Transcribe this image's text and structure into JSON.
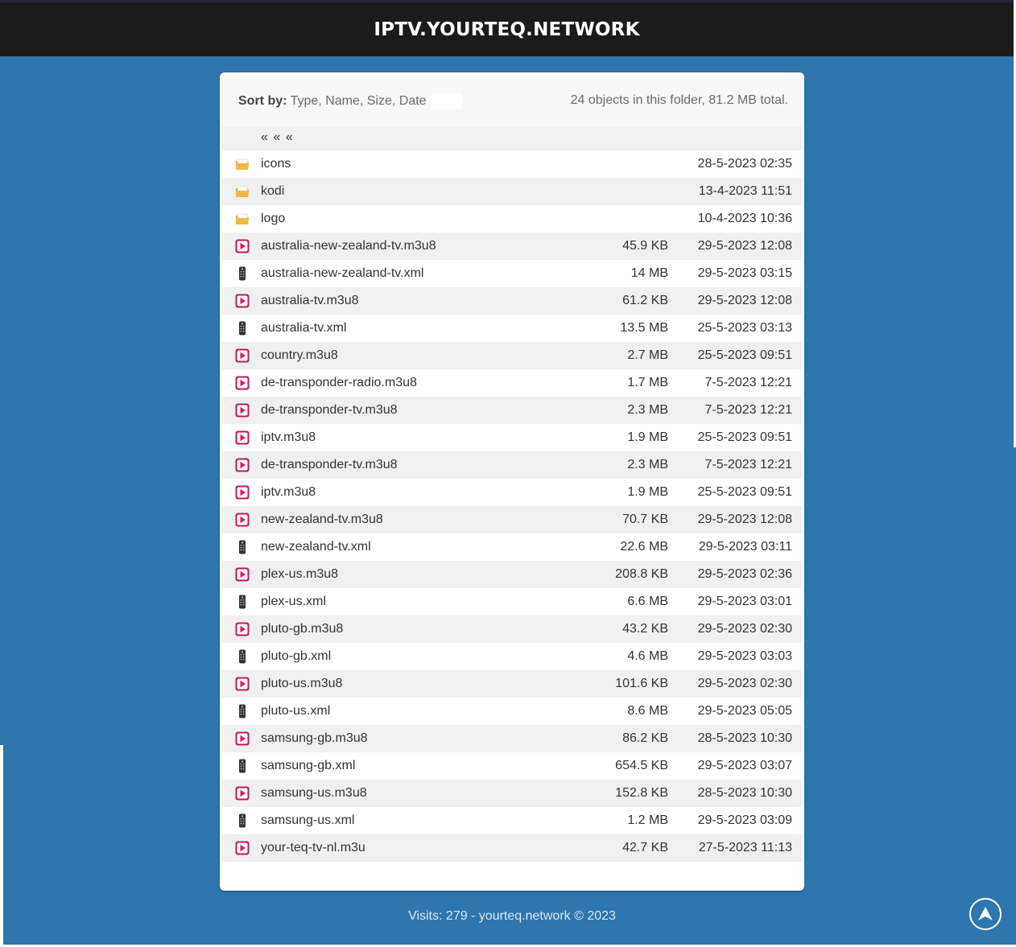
{
  "header": {
    "title": "IPTV.YOURTEQ.NETWORK"
  },
  "sort": {
    "label": "Sort by:",
    "options": "Type, Name, Size, Date"
  },
  "summary": "24 objects in this folder, 81.2 MB total.",
  "parent_link": "« « «",
  "rows": [
    {
      "type": "folder",
      "name": "icons",
      "size": "",
      "date": "28-5-2023 02:35"
    },
    {
      "type": "folder",
      "name": "kodi",
      "size": "",
      "date": "13-4-2023 11:51"
    },
    {
      "type": "folder",
      "name": "logo",
      "size": "",
      "date": "10-4-2023 10:36"
    },
    {
      "type": "playlist",
      "name": "australia-new-zealand-tv.m3u8",
      "size": "45.9 KB",
      "date": "29-5-2023 12:08"
    },
    {
      "type": "xml",
      "name": "australia-new-zealand-tv.xml",
      "size": "14 MB",
      "date": "29-5-2023 03:15"
    },
    {
      "type": "playlist",
      "name": "australia-tv.m3u8",
      "size": "61.2 KB",
      "date": "29-5-2023 12:08"
    },
    {
      "type": "xml",
      "name": "australia-tv.xml",
      "size": "13.5 MB",
      "date": "25-5-2023 03:13"
    },
    {
      "type": "playlist",
      "name": "country.m3u8",
      "size": "2.7 MB",
      "date": "25-5-2023 09:51"
    },
    {
      "type": "playlist",
      "name": "de-transponder-radio.m3u8",
      "size": "1.7 MB",
      "date": "7-5-2023 12:21"
    },
    {
      "type": "playlist",
      "name": "de-transponder-tv.m3u8",
      "size": "2.3 MB",
      "date": "7-5-2023 12:21"
    },
    {
      "type": "playlist",
      "name": "iptv.m3u8",
      "size": "1.9 MB",
      "date": "25-5-2023 09:51"
    },
    {
      "type": "playlist",
      "name": "de-transponder-tv.m3u8",
      "size": "2.3 MB",
      "date": "7-5-2023 12:21"
    },
    {
      "type": "playlist",
      "name": "iptv.m3u8",
      "size": "1.9 MB",
      "date": "25-5-2023 09:51"
    },
    {
      "type": "playlist",
      "name": "new-zealand-tv.m3u8",
      "size": "70.7 KB",
      "date": "29-5-2023 12:08"
    },
    {
      "type": "xml",
      "name": "new-zealand-tv.xml",
      "size": "22.6 MB",
      "date": "29-5-2023 03:11"
    },
    {
      "type": "playlist",
      "name": "plex-us.m3u8",
      "size": "208.8 KB",
      "date": "29-5-2023 02:36"
    },
    {
      "type": "xml",
      "name": "plex-us.xml",
      "size": "6.6 MB",
      "date": "29-5-2023 03:01"
    },
    {
      "type": "playlist",
      "name": "pluto-gb.m3u8",
      "size": "43.2 KB",
      "date": "29-5-2023 02:30"
    },
    {
      "type": "xml",
      "name": "pluto-gb.xml",
      "size": "4.6 MB",
      "date": "29-5-2023 03:03"
    },
    {
      "type": "playlist",
      "name": "pluto-us.m3u8",
      "size": "101.6 KB",
      "date": "29-5-2023 02:30"
    },
    {
      "type": "xml",
      "name": "pluto-us.xml",
      "size": "8.6 MB",
      "date": "29-5-2023 05:05"
    },
    {
      "type": "playlist",
      "name": "samsung-gb.m3u8",
      "size": "86.2 KB",
      "date": "28-5-2023 10:30"
    },
    {
      "type": "xml",
      "name": "samsung-gb.xml",
      "size": "654.5 KB",
      "date": "29-5-2023 03:07"
    },
    {
      "type": "playlist",
      "name": "samsung-us.m3u8",
      "size": "152.8 KB",
      "date": "28-5-2023 10:30"
    },
    {
      "type": "xml",
      "name": "samsung-us.xml",
      "size": "1.2 MB",
      "date": "29-5-2023 03:09"
    },
    {
      "type": "playlist",
      "name": "your-teq-tv-nl.m3u",
      "size": "42.7 KB",
      "date": "27-5-2023 11:13"
    }
  ],
  "icons": {
    "folder": "folder-icon",
    "playlist": "play-file-icon",
    "xml": "remote-file-icon",
    "back_to_top": "arrow-up-icon"
  },
  "colors": {
    "header_bg": "#1b1b1b",
    "page_bg": "#2e76ad",
    "playlist_icon": "#c2185b",
    "folder_icon": "#f0a830"
  },
  "footer": "Visits: 279 - yourteq.network © 2023"
}
